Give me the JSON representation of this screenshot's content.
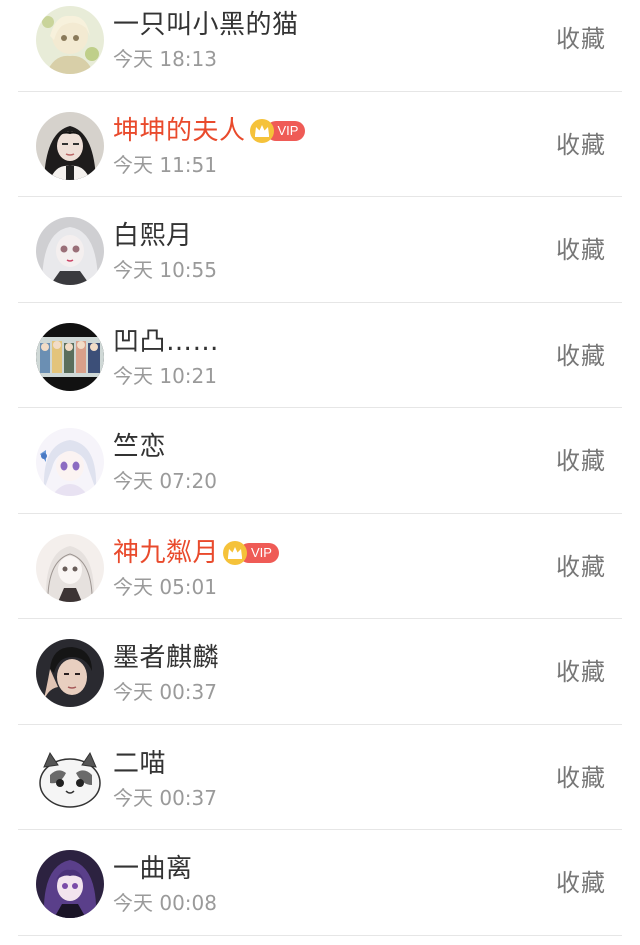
{
  "favorite_label": "收藏",
  "vip_label": "VIP",
  "colors": {
    "vip_name": "#e94a2c",
    "normal_name": "#333333",
    "time": "#9a9a9a",
    "divider": "#e6e6e6",
    "vip_badge": "#ef5b56",
    "crown": "#f5c23a"
  },
  "users": [
    {
      "name": "一只叫小黑的猫",
      "time": "今天 18:13",
      "vip": false,
      "avatar": "anime-girl-avatar"
    },
    {
      "name": "坤坤的夫人",
      "time": "今天 11:51",
      "vip": true,
      "avatar": "dark-hair-girl-avatar"
    },
    {
      "name": "白熙月",
      "time": "今天 10:55",
      "vip": false,
      "avatar": "white-hair-doll-avatar"
    },
    {
      "name": "凹凸……",
      "time": "今天 10:21",
      "vip": false,
      "avatar": "group-photo-avatar"
    },
    {
      "name": "竺恋",
      "time": "今天 07:20",
      "vip": false,
      "avatar": "anime-purple-eyes-avatar"
    },
    {
      "name": "神九粼月",
      "time": "今天 05:01",
      "vip": true,
      "avatar": "sketch-girl-avatar"
    },
    {
      "name": "墨者麒麟",
      "time": "今天 00:37",
      "vip": false,
      "avatar": "boy-portrait-avatar"
    },
    {
      "name": "二喵",
      "time": "今天 00:37",
      "vip": false,
      "avatar": "cartoon-cat-avatar"
    },
    {
      "name": "一曲离",
      "time": "今天 00:08",
      "vip": false,
      "avatar": "purple-hair-girl-avatar"
    }
  ]
}
